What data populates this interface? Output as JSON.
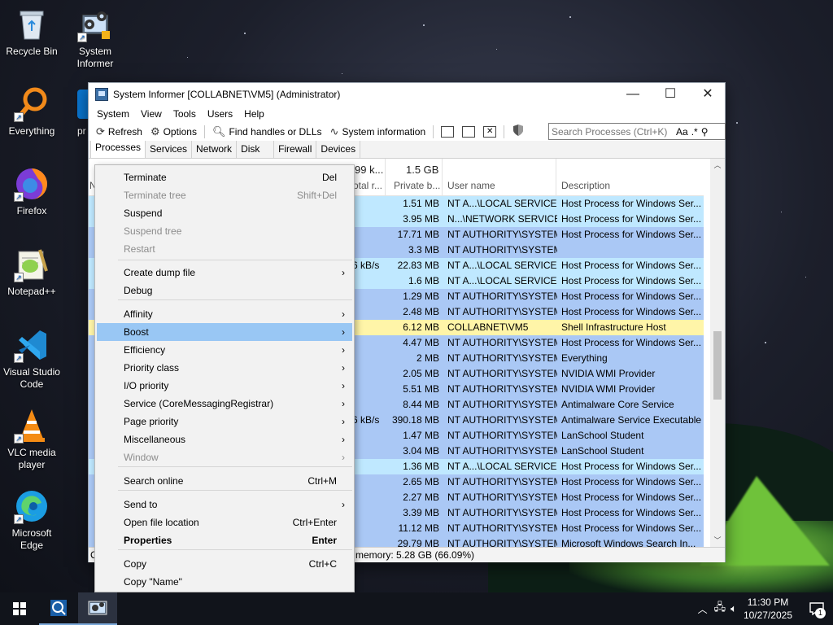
{
  "desktop_icons": [
    {
      "label": "Recycle Bin"
    },
    {
      "label": "System Informer"
    },
    {
      "label": "Everything"
    },
    {
      "label": "pr"
    },
    {
      "label": "Firefox"
    },
    {
      "label": "Notepad++"
    },
    {
      "label": "Visual Studio Code"
    },
    {
      "label": "VLC media player"
    },
    {
      "label": "Microsoft Edge"
    }
  ],
  "window": {
    "title": "System Informer [COLLABNET\\VM5] (Administrator)",
    "controls": {
      "minimize": "—",
      "maximize": "☐",
      "close": "✕"
    }
  },
  "menubar": [
    "System",
    "View",
    "Tools",
    "Users",
    "Help"
  ],
  "toolbar": {
    "refresh": "Refresh",
    "options": "Options",
    "find_handles": "Find handles or DLLs",
    "system_info": "System information",
    "search_placeholder": "Search Processes (Ctrl+K)",
    "search_aa": "Aa",
    "search_regex": ".*"
  },
  "tabs": [
    "Processes",
    "Services",
    "Network",
    "Disk",
    "Firewall",
    "Devices"
  ],
  "list_header": {
    "io_total": "99 k...",
    "io_label": "otal r...",
    "private_total": "1.5 GB",
    "private_label": "Private b...",
    "user_label": "User name",
    "desc_label": "Description",
    "name_fragment": "N"
  },
  "rows": [
    {
      "net": "",
      "private": "1.51 MB",
      "user": "NT A...\\LOCAL SERVICE",
      "desc": "Host Process for Windows Ser...",
      "color": "#bfe8ff"
    },
    {
      "net": "",
      "private": "3.95 MB",
      "user": "N...\\NETWORK SERVICE",
      "desc": "Host Process for Windows Ser...",
      "color": "#bfe8ff"
    },
    {
      "net": "",
      "private": "17.71 MB",
      "user": "NT AUTHORITY\\SYSTEM",
      "desc": "Host Process for Windows Ser...",
      "color": "#aac8f5"
    },
    {
      "net": "",
      "private": "3.3 MB",
      "user": "NT AUTHORITY\\SYSTEM",
      "desc": "",
      "color": "#aac8f5"
    },
    {
      "net": "6 kB/s",
      "private": "22.83 MB",
      "user": "NT A...\\LOCAL SERVICE",
      "desc": "Host Process for Windows Ser...",
      "color": "#bfe8ff"
    },
    {
      "net": "",
      "private": "1.6 MB",
      "user": "NT A...\\LOCAL SERVICE",
      "desc": "Host Process for Windows Ser...",
      "color": "#bfe8ff"
    },
    {
      "net": "",
      "private": "1.29 MB",
      "user": "NT AUTHORITY\\SYSTEM",
      "desc": "Host Process for Windows Ser...",
      "color": "#aac8f5"
    },
    {
      "net": "",
      "private": "2.48 MB",
      "user": "NT AUTHORITY\\SYSTEM",
      "desc": "Host Process for Windows Ser...",
      "color": "#aac8f5"
    },
    {
      "net": "",
      "private": "6.12 MB",
      "user": "COLLABNET\\VM5",
      "desc": "Shell Infrastructure Host",
      "color": "#fff5a8"
    },
    {
      "net": "",
      "private": "4.47 MB",
      "user": "NT AUTHORITY\\SYSTEM",
      "desc": "Host Process for Windows Ser...",
      "color": "#aac8f5"
    },
    {
      "net": "",
      "private": "2 MB",
      "user": "NT AUTHORITY\\SYSTEM",
      "desc": "Everything",
      "color": "#aac8f5"
    },
    {
      "net": "",
      "private": "2.05 MB",
      "user": "NT AUTHORITY\\SYSTEM",
      "desc": "NVIDIA WMI Provider",
      "color": "#aac8f5"
    },
    {
      "net": "",
      "private": "5.51 MB",
      "user": "NT AUTHORITY\\SYSTEM",
      "desc": "NVIDIA WMI Provider",
      "color": "#aac8f5"
    },
    {
      "net": "",
      "private": "8.44 MB",
      "user": "NT AUTHORITY\\SYSTEM",
      "desc": "Antimalware Core Service",
      "color": "#aac8f5"
    },
    {
      "net": "6 kB/s",
      "private": "390.18 MB",
      "user": "NT AUTHORITY\\SYSTEM",
      "desc": "Antimalware Service Executable",
      "color": "#aac8f5"
    },
    {
      "net": "",
      "private": "1.47 MB",
      "user": "NT AUTHORITY\\SYSTEM",
      "desc": "LanSchool Student",
      "color": "#aac8f5"
    },
    {
      "net": "",
      "private": "3.04 MB",
      "user": "NT AUTHORITY\\SYSTEM",
      "desc": "LanSchool Student",
      "color": "#aac8f5"
    },
    {
      "net": "",
      "private": "1.36 MB",
      "user": "NT A...\\LOCAL SERVICE",
      "desc": "Host Process for Windows Ser...",
      "color": "#bfe8ff"
    },
    {
      "net": "",
      "private": "2.65 MB",
      "user": "NT AUTHORITY\\SYSTEM",
      "desc": "Host Process for Windows Ser...",
      "color": "#aac8f5"
    },
    {
      "net": "",
      "private": "2.27 MB",
      "user": "NT AUTHORITY\\SYSTEM",
      "desc": "Host Process for Windows Ser...",
      "color": "#aac8f5"
    },
    {
      "net": "",
      "private": "3.39 MB",
      "user": "NT AUTHORITY\\SYSTEM",
      "desc": "Host Process for Windows Ser...",
      "color": "#aac8f5"
    },
    {
      "net": "",
      "private": "11.12 MB",
      "user": "NT AUTHORITY\\SYSTEM",
      "desc": "Host Process for Windows Ser...",
      "color": "#aac8f5"
    },
    {
      "net": "",
      "private": "29.79 MB",
      "user": "NT AUTHORITY\\SYSTEM",
      "desc": "Microsoft Windows Search In...",
      "color": "#aac8f5"
    }
  ],
  "statusbar": {
    "left": "C",
    "memory": "memory: 5.28 GB (66.09%)"
  },
  "context_menu": {
    "items": [
      {
        "label": "Terminate",
        "shortcut": "Del",
        "disabled": false
      },
      {
        "label": "Terminate tree",
        "shortcut": "Shift+Del",
        "disabled": true
      },
      {
        "label": "Suspend",
        "shortcut": "",
        "disabled": false
      },
      {
        "label": "Suspend tree",
        "shortcut": "",
        "disabled": true
      },
      {
        "label": "Restart",
        "shortcut": "",
        "disabled": true
      },
      {
        "label": "Create dump file",
        "shortcut": "",
        "disabled": false,
        "submenu": true
      },
      {
        "label": "Debug",
        "shortcut": "",
        "disabled": false
      },
      {
        "label": "Affinity",
        "shortcut": "",
        "disabled": false,
        "submenu": true
      },
      {
        "label": "Boost",
        "shortcut": "",
        "disabled": false,
        "submenu": true,
        "selected": true
      },
      {
        "label": "Efficiency",
        "shortcut": "",
        "disabled": false,
        "submenu": true
      },
      {
        "label": "Priority class",
        "shortcut": "",
        "disabled": false,
        "submenu": true
      },
      {
        "label": "I/O priority",
        "shortcut": "",
        "disabled": false,
        "submenu": true
      },
      {
        "label": "Service (CoreMessagingRegistrar)",
        "shortcut": "",
        "disabled": false,
        "submenu": true
      },
      {
        "label": "Page priority",
        "shortcut": "",
        "disabled": false,
        "submenu": true
      },
      {
        "label": "Miscellaneous",
        "shortcut": "",
        "disabled": false,
        "submenu": true
      },
      {
        "label": "Window",
        "shortcut": "",
        "disabled": true,
        "submenu": true
      },
      {
        "label": "Search online",
        "shortcut": "Ctrl+M",
        "disabled": false
      },
      {
        "label": "Send to",
        "shortcut": "",
        "disabled": false,
        "submenu": true
      },
      {
        "label": "Open file location",
        "shortcut": "Ctrl+Enter",
        "disabled": false
      },
      {
        "label": "Properties",
        "shortcut": "Enter",
        "disabled": false,
        "bold": true
      },
      {
        "label": "Copy",
        "shortcut": "Ctrl+C",
        "disabled": false
      },
      {
        "label": "Copy \"Name\"",
        "shortcut": "",
        "disabled": false
      }
    ],
    "arrow": "›"
  },
  "taskbar": {
    "time": "11:30 PM",
    "date": "10/27/2025",
    "notification_count": "1"
  }
}
